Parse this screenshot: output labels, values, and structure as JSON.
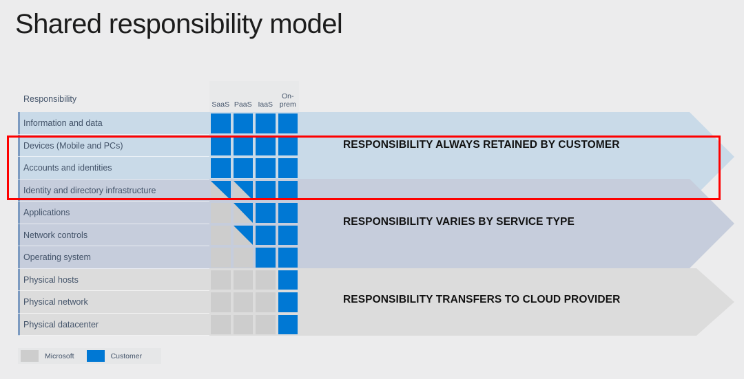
{
  "slide": {
    "title": "Shared responsibility model",
    "background_color": "#ececed"
  },
  "table": {
    "header": {
      "responsibility_label": "Responsibility",
      "columns": [
        "SaaS",
        "PaaS",
        "IaaS",
        "On-\nprem"
      ],
      "column_labels_flat": [
        "SaaS",
        "PaaS",
        "IaaS",
        "On-prem"
      ]
    },
    "rows": [
      {
        "label": "Information and data",
        "band": 0,
        "cells": [
          "customer",
          "customer",
          "customer",
          "customer"
        ]
      },
      {
        "label": "Devices (Mobile and PCs)",
        "band": 0,
        "cells": [
          "customer",
          "customer",
          "customer",
          "customer"
        ]
      },
      {
        "label": "Accounts and identities",
        "band": 0,
        "cells": [
          "customer",
          "customer",
          "customer",
          "customer"
        ]
      },
      {
        "label": "Identity and directory infrastructure",
        "band": 1,
        "cells": [
          "split",
          "split",
          "customer",
          "customer"
        ]
      },
      {
        "label": "Applications",
        "band": 1,
        "cells": [
          "microsoft",
          "split",
          "customer",
          "customer"
        ]
      },
      {
        "label": "Network controls",
        "band": 1,
        "cells": [
          "microsoft",
          "split",
          "customer",
          "customer"
        ]
      },
      {
        "label": "Operating system",
        "band": 1,
        "cells": [
          "microsoft",
          "microsoft",
          "customer",
          "customer"
        ]
      },
      {
        "label": "Physical hosts",
        "band": 2,
        "cells": [
          "microsoft",
          "microsoft",
          "microsoft",
          "customer"
        ]
      },
      {
        "label": "Physical network",
        "band": 2,
        "cells": [
          "microsoft",
          "microsoft",
          "microsoft",
          "customer"
        ]
      },
      {
        "label": "Physical datacenter",
        "band": 2,
        "cells": [
          "microsoft",
          "microsoft",
          "microsoft",
          "customer"
        ]
      }
    ]
  },
  "bands": [
    {
      "label": "RESPONSIBILITY ALWAYS RETAINED BY CUSTOMER",
      "color": "#c9dae8"
    },
    {
      "label": "RESPONSIBILITY VARIES BY SERVICE TYPE",
      "color": "#c6cddc"
    },
    {
      "label": "RESPONSIBILITY TRANSFERS TO CLOUD PROVIDER",
      "color": "#dcdcdc"
    }
  ],
  "legend": {
    "items": [
      {
        "label": "Microsoft",
        "color": "#cdcdcd"
      },
      {
        "label": "Customer",
        "color": "#0078d4"
      }
    ]
  },
  "highlight": {
    "color": "#fe0000",
    "covers_rows": [
      "Devices (Mobile and PCs)",
      "Accounts and identities",
      "Identity and directory infrastructure"
    ]
  }
}
